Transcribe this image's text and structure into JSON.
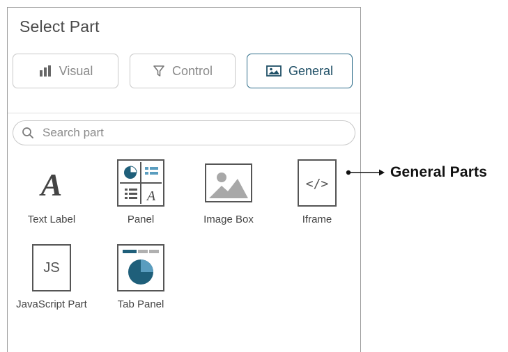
{
  "panel": {
    "title": "Select Part",
    "tabs": [
      {
        "label": "Visual",
        "icon": "bar-chart-icon",
        "active": false
      },
      {
        "label": "Control",
        "icon": "filter-icon",
        "active": false
      },
      {
        "label": "General",
        "icon": "image-icon",
        "active": true
      }
    ],
    "search": {
      "placeholder": "Search part",
      "value": ""
    },
    "parts": [
      {
        "label": "Text Label",
        "icon": "text-label-icon"
      },
      {
        "label": "Panel",
        "icon": "panel-icon"
      },
      {
        "label": "Image Box",
        "icon": "image-box-icon"
      },
      {
        "label": "Iframe",
        "icon": "iframe-icon"
      },
      {
        "label": "JavaScript Part",
        "icon": "javascript-icon"
      },
      {
        "label": "Tab Panel",
        "icon": "tab-panel-icon"
      }
    ]
  },
  "annotation": {
    "text": "General Parts"
  },
  "colors": {
    "accent": "#2b6b88",
    "icon_blue": "#1f5f7a",
    "border": "#c8c8c8"
  }
}
